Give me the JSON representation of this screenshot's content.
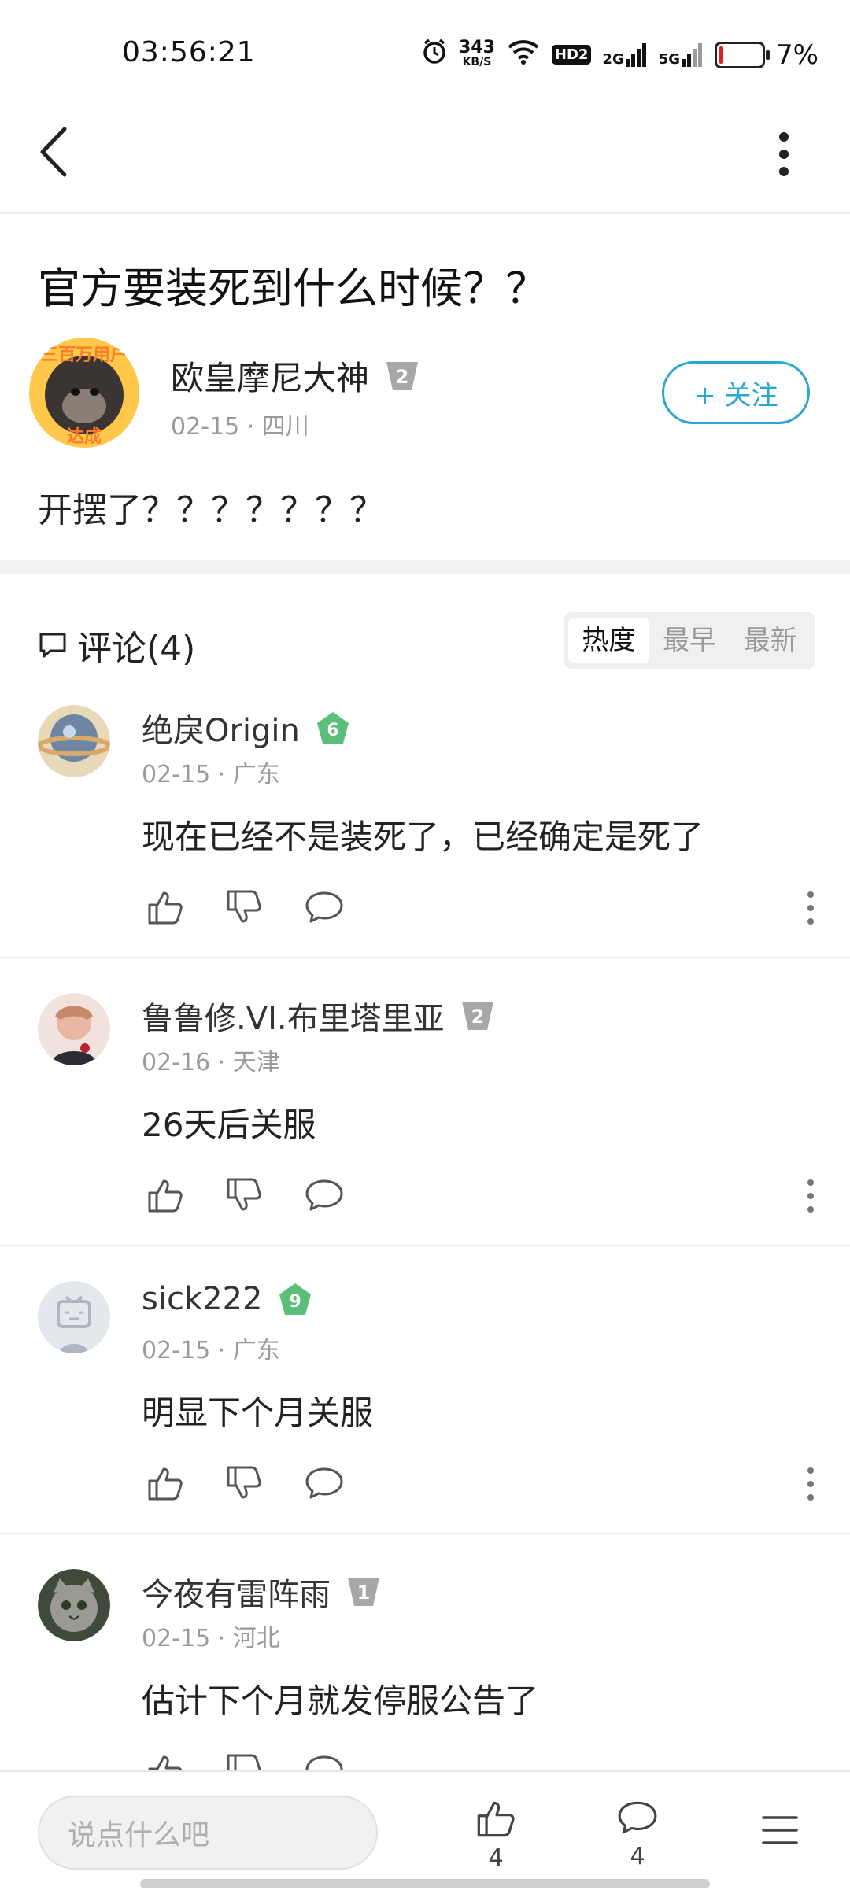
{
  "status_bar": {
    "time": "03:56:21",
    "net_speed": "343",
    "net_unit": "KB/S",
    "hd_label": "HD2",
    "sig1_label": "2G",
    "sig2_label": "5G",
    "battery_text": "7%",
    "battery_level": 0.07,
    "battery_color": "#e02020"
  },
  "post": {
    "title": "官方要装死到什么时候？？",
    "author": {
      "name": "欧皇摩尼大神",
      "level": "2",
      "meta": "02-15 · 四川",
      "avatar_badge_top": "三百万用户",
      "avatar_badge_bottom": "达成"
    },
    "follow_label": "+ 关注",
    "body": "开摆了？？？？？？？"
  },
  "comments_section": {
    "title": "评论(4)",
    "sort_tabs": [
      "热度",
      "最早",
      "最新"
    ],
    "active_sort": "热度"
  },
  "comments": [
    {
      "name": "绝戾Origin",
      "level": "6",
      "level_color": "#5bbf7a",
      "meta": "02-15 · 广东",
      "text": "现在已经不是装死了，已经确定是死了"
    },
    {
      "name": "鲁鲁修.VI.布里塔里亚",
      "level": "2",
      "level_color": "#a7a7a7",
      "meta": "02-16 · 天津",
      "text": "26天后关服"
    },
    {
      "name": "sick222",
      "level": "9",
      "level_color": "#5bbf7a",
      "meta": "02-15 · 广东",
      "text": "明显下个月关服"
    },
    {
      "name": "今夜有雷阵雨",
      "level": "1",
      "level_color": "#a7a7a7",
      "meta": "02-15 · 河北",
      "text": "估计下个月就发停服公告了"
    }
  ],
  "bottom_bar": {
    "input_placeholder": "说点什么吧",
    "like_count": "4",
    "comment_count": "4"
  },
  "colors": {
    "accent": "#2aa7cf",
    "level_green": "#5bbf7a",
    "level_gray": "#a7a7a7"
  }
}
